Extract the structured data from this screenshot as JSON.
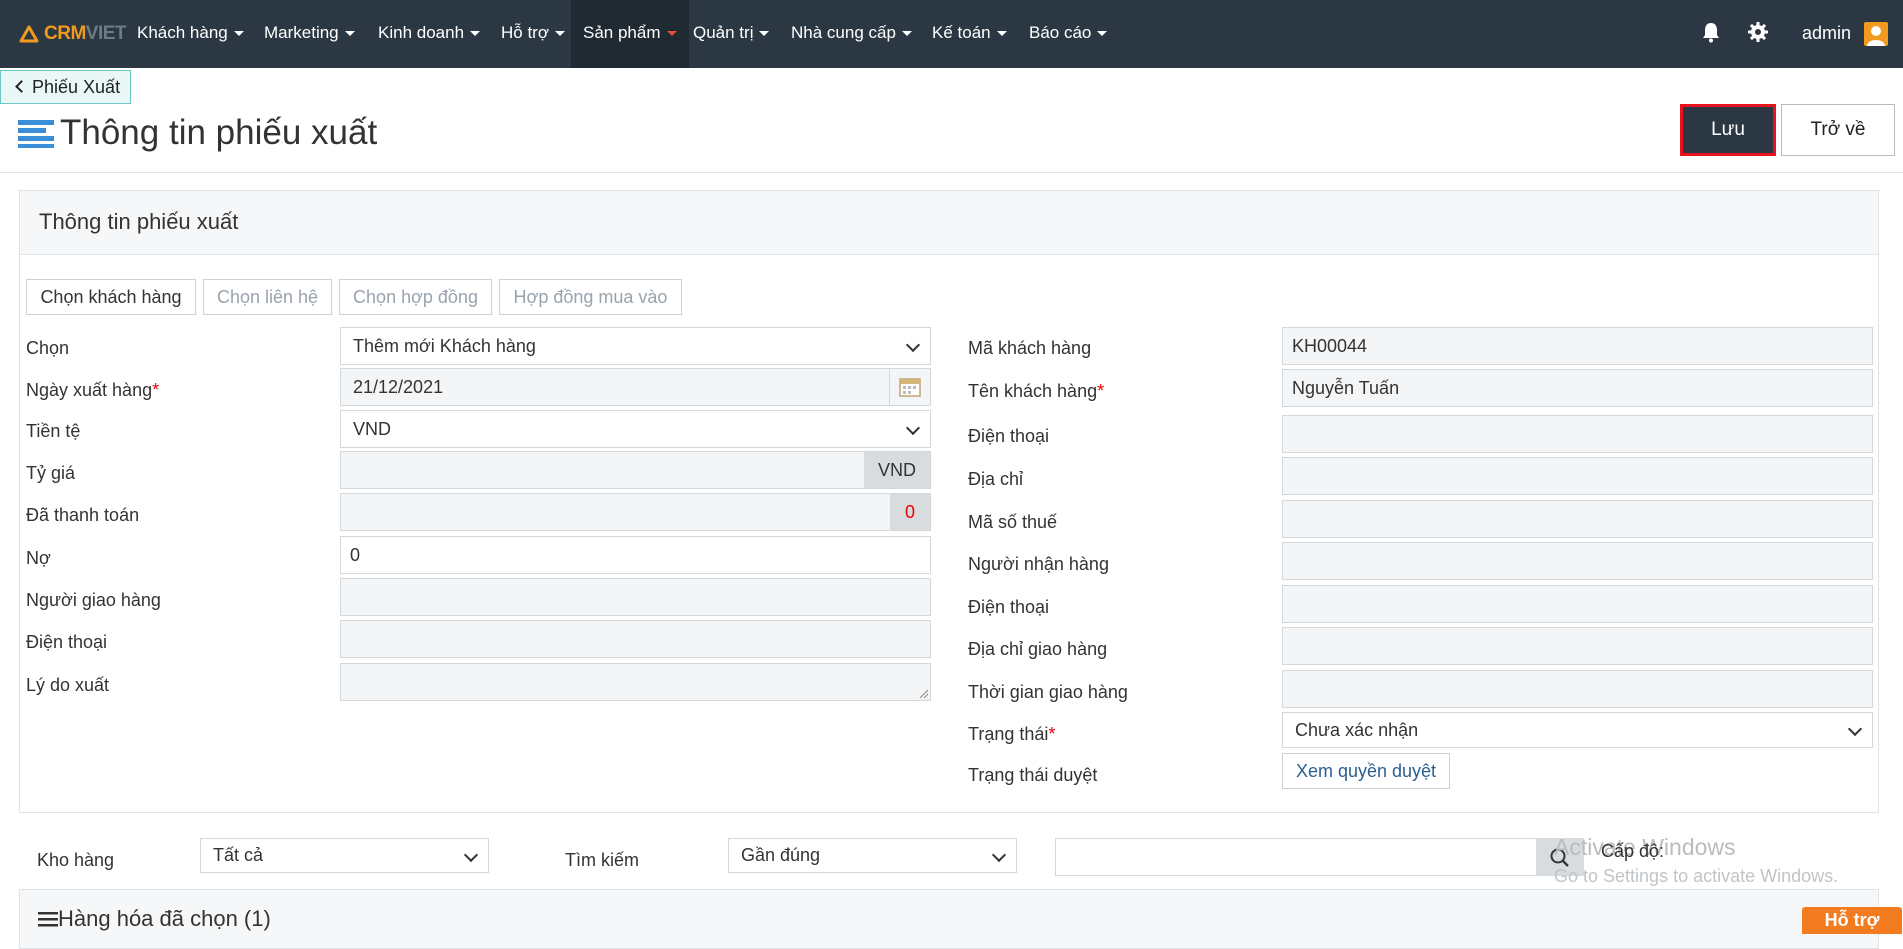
{
  "brand": {
    "part1": "CRM",
    "part2": "VIET"
  },
  "nav": [
    {
      "label": "Khách hàng"
    },
    {
      "label": "Marketing"
    },
    {
      "label": "Kinh doanh"
    },
    {
      "label": "Hỗ trợ"
    },
    {
      "label": "Sản phẩm",
      "active": true
    },
    {
      "label": "Quản trị"
    },
    {
      "label": "Nhà cung cấp"
    },
    {
      "label": "Kế toán"
    },
    {
      "label": "Báo cáo"
    }
  ],
  "user": {
    "name": "admin"
  },
  "breadcrumb": {
    "back_label": "Phiếu Xuất"
  },
  "page": {
    "title": "Thông tin phiếu xuất"
  },
  "actions": {
    "save": "Lưu",
    "back": "Trở về"
  },
  "panel": {
    "title": "Thông tin phiếu xuất",
    "tabs": [
      "Chọn khách hàng",
      "Chọn liên hệ",
      "Chọn hợp đồng",
      "Hợp đồng mua vào"
    ]
  },
  "left": {
    "chon": {
      "label": "Chọn",
      "value": "Thêm mới Khách hàng"
    },
    "ngay_xuat": {
      "label": "Ngày xuất hàng",
      "value": "21/12/2021"
    },
    "tien_te": {
      "label": "Tiền tệ",
      "value": "VND"
    },
    "ty_gia": {
      "label": "Tỷ giá",
      "value": "",
      "addon": "VND"
    },
    "da_thanh_toan": {
      "label": "Đã thanh toán",
      "value": "",
      "addon": "0"
    },
    "no": {
      "label": "Nợ",
      "value": "0"
    },
    "nguoi_giao": {
      "label": "Người giao hàng",
      "value": ""
    },
    "dien_thoai": {
      "label": "Điện thoại",
      "value": ""
    },
    "ly_do": {
      "label": "Lý do xuất",
      "value": ""
    }
  },
  "right": {
    "ma_kh": {
      "label": "Mã khách hàng",
      "value": "KH00044"
    },
    "ten_kh": {
      "label": "Tên khách hàng",
      "value": "Nguyễn Tuấn"
    },
    "dien_thoai": {
      "label": "Điện thoại",
      "value": ""
    },
    "dia_chi": {
      "label": "Địa chỉ",
      "value": ""
    },
    "ma_so_thue": {
      "label": "Mã số thuế",
      "value": ""
    },
    "nguoi_nhan": {
      "label": "Người nhận hàng",
      "value": ""
    },
    "dien_thoai2": {
      "label": "Điện thoại",
      "value": ""
    },
    "dia_chi_giao": {
      "label": "Địa chỉ giao hàng",
      "value": ""
    },
    "thoi_gian": {
      "label": "Thời gian giao hàng",
      "value": ""
    },
    "trang_thai": {
      "label": "Trạng thái",
      "value": "Chưa xác nhận"
    },
    "trang_thai_duyet": {
      "label": "Trạng thái duyệt",
      "button": "Xem quyền duyệt"
    }
  },
  "filter": {
    "kho_label": "Kho hàng",
    "kho_value": "Tất cả",
    "search_label": "Tìm kiếm",
    "search_mode": "Gần đúng",
    "search_value": "",
    "level_label": "Cấp độ:"
  },
  "selected": {
    "title": "Hàng hóa đã chọn (1)"
  },
  "support": {
    "label": "Hỗ trợ"
  },
  "watermark": {
    "line1": "Activate Windows",
    "line2": "Go to Settings to activate Windows."
  },
  "colors": {
    "navbar": "#2b3843",
    "accent": "#f29a1e",
    "save_border": "#e8131e",
    "support": "#f47c20"
  }
}
